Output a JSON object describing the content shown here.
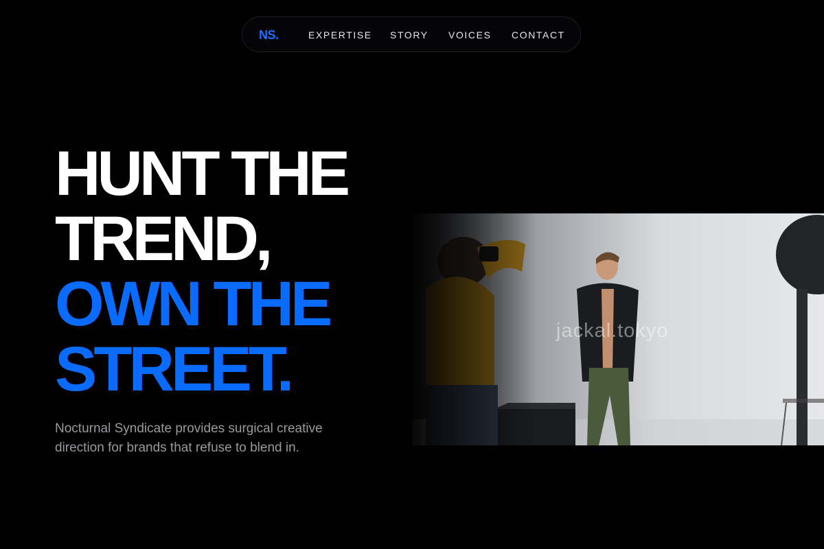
{
  "nav": {
    "logo": "NS.",
    "links": [
      "EXPERTISE",
      "STORY",
      "VOICES",
      "CONTACT"
    ]
  },
  "hero": {
    "headline_white": [
      "HUNT THE",
      "TREND,"
    ],
    "headline_blue": [
      "OWN THE",
      "STREET."
    ],
    "subtext": "Nocturnal Syndicate provides surgical creative direction for brands that refuse to blend in.",
    "image_watermark": "jackal.tokyo"
  },
  "colors": {
    "background": "#000000",
    "accent": "#0a6bff",
    "text_primary": "#ffffff",
    "text_muted": "#9a9a9f"
  }
}
